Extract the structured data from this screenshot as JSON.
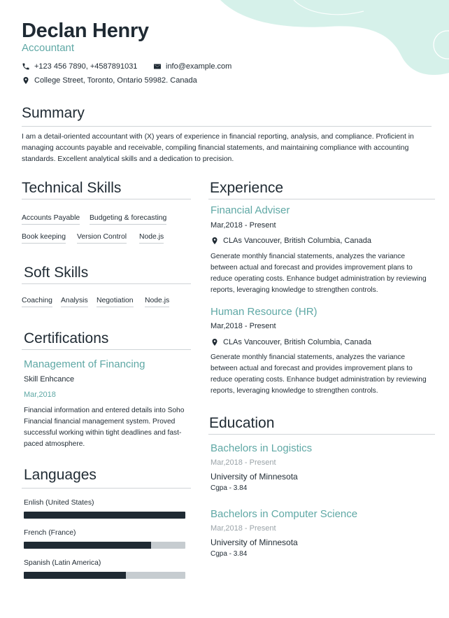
{
  "header": {
    "name": "Declan Henry",
    "title": "Accountant",
    "phone": "+123 456 7890, +4587891031",
    "email": "info@example.com",
    "address": "College Street, Toronto, Ontario 59982. Canada"
  },
  "summary": {
    "heading": "Summary",
    "text": "I am a detail-oriented accountant with (X) years of experience in financial reporting, analysis, and compliance. Proficient in managing accounts payable and receivable, compiling financial statements, and maintaining compliance with accounting standards. Excellent analytical skills and a dedication to precision."
  },
  "technical_skills": {
    "heading": "Technical Skills",
    "items": [
      "Accounts Payable",
      "Budgeting & forecasting",
      "Book keeping",
      "Version Control",
      "Node.js"
    ]
  },
  "soft_skills": {
    "heading": "Soft Skills",
    "items": [
      "Coaching",
      "Analysis",
      "Negotiation",
      "Node.js"
    ]
  },
  "certifications": {
    "heading": "Certifications",
    "items": [
      {
        "title": "Management of Financing",
        "subtitle": "Skill Enhcance",
        "date": "Mar,2018",
        "description": "Financial information and entered details into Soho Financial financial management system. Proved successful working within tight deadlines and fast-paced atmosphere."
      }
    ]
  },
  "languages": {
    "heading": "Languages",
    "items": [
      {
        "name": "Enlish (United States)",
        "level": 1.0
      },
      {
        "name": "French (France)",
        "level": 0.79
      },
      {
        "name": "Spanish (Latin America)",
        "level": 0.63
      }
    ]
  },
  "experience": {
    "heading": "Experience",
    "items": [
      {
        "title": "Financial Adviser",
        "date": "Mar,2018 - Present",
        "location": "CLAs Vancouver, British Columbia, Canada",
        "description": "Generate monthly financial statements, analyzes the variance between actual and forecast and provides improvement plans to reduce operating costs. Enhance budget administration by reviewing reports, leveraging knowledge to strengthen controls."
      },
      {
        "title": "Human Resource (HR)",
        "date": "Mar,2018 - Present",
        "location": "CLAs Vancouver, British Columbia, Canada",
        "description": "Generate monthly financial statements, analyzes the variance between actual and forecast and provides improvement plans to reduce operating costs. Enhance budget administration by reviewing reports, leveraging knowledge to strengthen controls."
      }
    ]
  },
  "education": {
    "heading": "Education",
    "items": [
      {
        "degree": "Bachelors in Logistics",
        "date": "Mar,2018 - Present",
        "school": "University of Minnesota",
        "gpa": "Cgpa - 3.84"
      },
      {
        "degree": "Bachelors in Computer Science",
        "date": "Mar,2018 - Present",
        "school": "University of Minnesota",
        "gpa": "Cgpa - 3.84"
      }
    ]
  },
  "colors": {
    "accent": "#5fa8a5",
    "text": "#1f2a33",
    "blob": "#d6f1ea",
    "bar_track": "#c6ccd0"
  },
  "icons": {
    "phone": "phone-icon",
    "email": "envelope-icon",
    "location": "map-pin-icon"
  }
}
